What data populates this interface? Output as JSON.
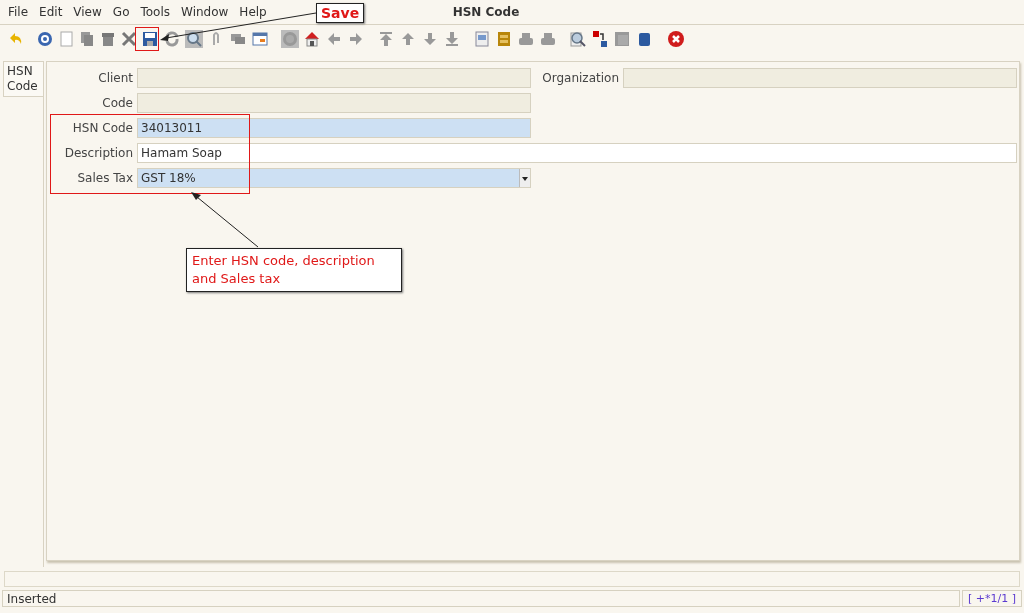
{
  "menu": [
    "File",
    "Edit",
    "View",
    "Go",
    "Tools",
    "Window",
    "Help"
  ],
  "window": {
    "title": "HSN Code"
  },
  "tabs": [
    {
      "label": "HSN Code",
      "selected": true
    }
  ],
  "fields": [
    {
      "label": "Client",
      "kind": "readonly"
    },
    {
      "label": "Organization",
      "kind": "readonly"
    },
    {
      "label": "Code",
      "kind": "readonly"
    },
    {
      "label": "HSN Code",
      "kind": "mandatory",
      "value": "34013011"
    },
    {
      "label": "Description",
      "kind": "text",
      "value": "Hamam Soap"
    },
    {
      "label": "Sales Tax",
      "kind": "select",
      "value": "GST 18%"
    }
  ],
  "annotations": [
    {
      "kind": "save",
      "text": "Save"
    },
    {
      "kind": "fields",
      "text": "Enter HSN code, description and Sales tax"
    }
  ],
  "status_bar": {
    "message": "Inserted",
    "record": "[ +*1/1 ]"
  }
}
